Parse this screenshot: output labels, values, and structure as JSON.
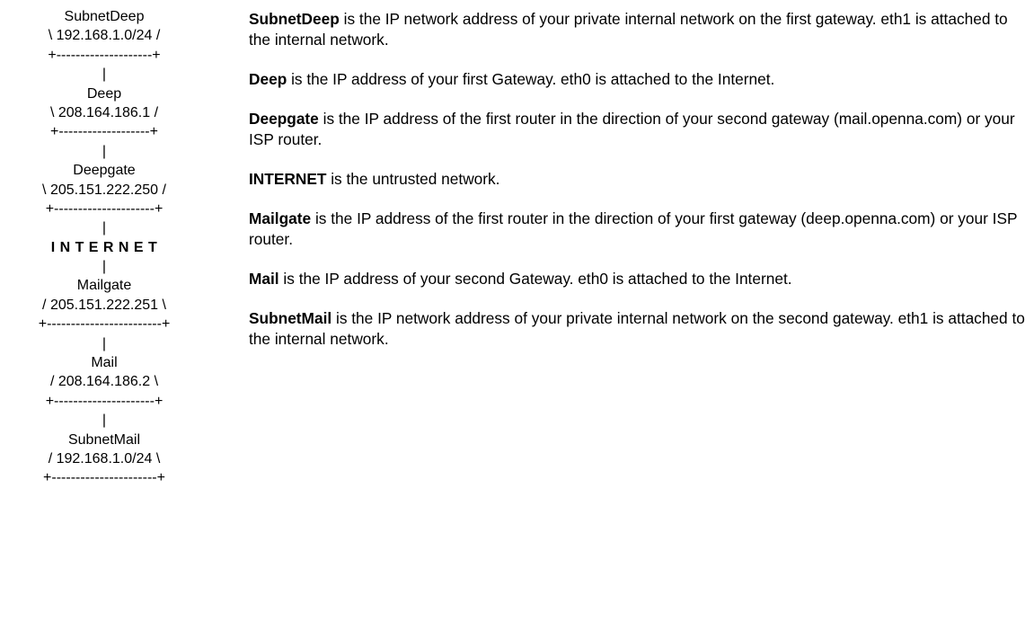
{
  "diagram": {
    "lines": [
      {
        "text": "SubnetDeep",
        "kind": "label"
      },
      {
        "text": "\\ 192.168.1.0/24 /",
        "kind": "address"
      },
      {
        "text": "+--------------------+",
        "kind": "border"
      },
      {
        "text": "|",
        "kind": "link"
      },
      {
        "text": "Deep",
        "kind": "label"
      },
      {
        "text": "\\ 208.164.186.1 /",
        "kind": "address"
      },
      {
        "text": "+-------------------+",
        "kind": "border"
      },
      {
        "text": "|",
        "kind": "link"
      },
      {
        "text": "Deepgate",
        "kind": "label"
      },
      {
        "text": "\\ 205.151.222.250 /",
        "kind": "address"
      },
      {
        "text": "+---------------------+",
        "kind": "border"
      },
      {
        "text": "|",
        "kind": "link"
      },
      {
        "text": "I N T E R N E T",
        "kind": "internet"
      },
      {
        "text": "|",
        "kind": "link"
      },
      {
        "text": "Mailgate",
        "kind": "label"
      },
      {
        "text": "/ 205.151.222.251 \\",
        "kind": "address"
      },
      {
        "text": "+------------------------+",
        "kind": "border"
      },
      {
        "text": "|",
        "kind": "link"
      },
      {
        "text": "Mail",
        "kind": "label"
      },
      {
        "text": "/ 208.164.186.2 \\",
        "kind": "address"
      },
      {
        "text": "+---------------------+",
        "kind": "border"
      },
      {
        "text": "|",
        "kind": "link"
      },
      {
        "text": "SubnetMail",
        "kind": "label"
      },
      {
        "text": "/ 192.168.1.0/24 \\",
        "kind": "address"
      },
      {
        "text": "+----------------------+",
        "kind": "border"
      }
    ]
  },
  "definitions": [
    {
      "term": "SubnetDeep",
      "text": " is the IP network address of your private internal network on the first gateway. eth1 is attached to the internal network."
    },
    {
      "term": "Deep",
      "text": " is the IP address of your first Gateway. eth0 is attached to the Internet."
    },
    {
      "term": "Deepgate",
      "text": " is the IP address of the first router in the direction of your second gateway (mail.openna.com) or your ISP router."
    },
    {
      "term": "INTERNET",
      "text": " is the untrusted network."
    },
    {
      "term": "Mailgate",
      "text": " is the IP address of the first router in the direction of your first gateway (deep.openna.com) or your ISP router."
    },
    {
      "term": "Mail",
      "text": " is the IP address of your second Gateway. eth0 is attached to the Internet."
    },
    {
      "term": "SubnetMail",
      "text": " is the IP network address of your private internal network on the second gateway. eth1 is attached to the internal network."
    }
  ]
}
